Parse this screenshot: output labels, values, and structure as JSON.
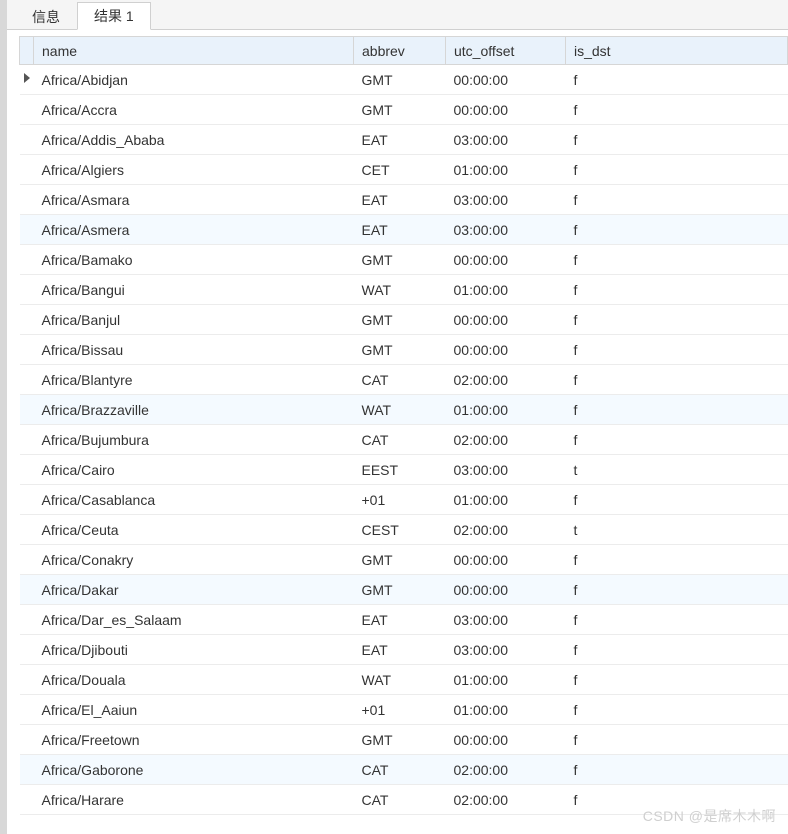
{
  "tabs": {
    "info": "信息",
    "result1": "结果 1"
  },
  "columns": {
    "name": "name",
    "abbrev": "abbrev",
    "utc_offset": "utc_offset",
    "is_dst": "is_dst"
  },
  "rows": [
    {
      "name": "Africa/Abidjan",
      "abbrev": "GMT",
      "utc_offset": "00:00:00",
      "is_dst": "f",
      "current": true
    },
    {
      "name": "Africa/Accra",
      "abbrev": "GMT",
      "utc_offset": "00:00:00",
      "is_dst": "f"
    },
    {
      "name": "Africa/Addis_Ababa",
      "abbrev": "EAT",
      "utc_offset": "03:00:00",
      "is_dst": "f"
    },
    {
      "name": "Africa/Algiers",
      "abbrev": "CET",
      "utc_offset": "01:00:00",
      "is_dst": "f"
    },
    {
      "name": "Africa/Asmara",
      "abbrev": "EAT",
      "utc_offset": "03:00:00",
      "is_dst": "f"
    },
    {
      "name": "Africa/Asmera",
      "abbrev": "EAT",
      "utc_offset": "03:00:00",
      "is_dst": "f",
      "alt": true
    },
    {
      "name": "Africa/Bamako",
      "abbrev": "GMT",
      "utc_offset": "00:00:00",
      "is_dst": "f"
    },
    {
      "name": "Africa/Bangui",
      "abbrev": "WAT",
      "utc_offset": "01:00:00",
      "is_dst": "f"
    },
    {
      "name": "Africa/Banjul",
      "abbrev": "GMT",
      "utc_offset": "00:00:00",
      "is_dst": "f"
    },
    {
      "name": "Africa/Bissau",
      "abbrev": "GMT",
      "utc_offset": "00:00:00",
      "is_dst": "f"
    },
    {
      "name": "Africa/Blantyre",
      "abbrev": "CAT",
      "utc_offset": "02:00:00",
      "is_dst": "f"
    },
    {
      "name": "Africa/Brazzaville",
      "abbrev": "WAT",
      "utc_offset": "01:00:00",
      "is_dst": "f",
      "alt": true
    },
    {
      "name": "Africa/Bujumbura",
      "abbrev": "CAT",
      "utc_offset": "02:00:00",
      "is_dst": "f"
    },
    {
      "name": "Africa/Cairo",
      "abbrev": "EEST",
      "utc_offset": "03:00:00",
      "is_dst": "t"
    },
    {
      "name": "Africa/Casablanca",
      "abbrev": "+01",
      "utc_offset": "01:00:00",
      "is_dst": "f"
    },
    {
      "name": "Africa/Ceuta",
      "abbrev": "CEST",
      "utc_offset": "02:00:00",
      "is_dst": "t"
    },
    {
      "name": "Africa/Conakry",
      "abbrev": "GMT",
      "utc_offset": "00:00:00",
      "is_dst": "f"
    },
    {
      "name": "Africa/Dakar",
      "abbrev": "GMT",
      "utc_offset": "00:00:00",
      "is_dst": "f",
      "alt": true
    },
    {
      "name": "Africa/Dar_es_Salaam",
      "abbrev": "EAT",
      "utc_offset": "03:00:00",
      "is_dst": "f"
    },
    {
      "name": "Africa/Djibouti",
      "abbrev": "EAT",
      "utc_offset": "03:00:00",
      "is_dst": "f"
    },
    {
      "name": "Africa/Douala",
      "abbrev": "WAT",
      "utc_offset": "01:00:00",
      "is_dst": "f"
    },
    {
      "name": "Africa/El_Aaiun",
      "abbrev": "+01",
      "utc_offset": "01:00:00",
      "is_dst": "f"
    },
    {
      "name": "Africa/Freetown",
      "abbrev": "GMT",
      "utc_offset": "00:00:00",
      "is_dst": "f"
    },
    {
      "name": "Africa/Gaborone",
      "abbrev": "CAT",
      "utc_offset": "02:00:00",
      "is_dst": "f",
      "alt": true
    },
    {
      "name": "Africa/Harare",
      "abbrev": "CAT",
      "utc_offset": "02:00:00",
      "is_dst": "f"
    }
  ],
  "watermark": "CSDN @是席木木啊"
}
